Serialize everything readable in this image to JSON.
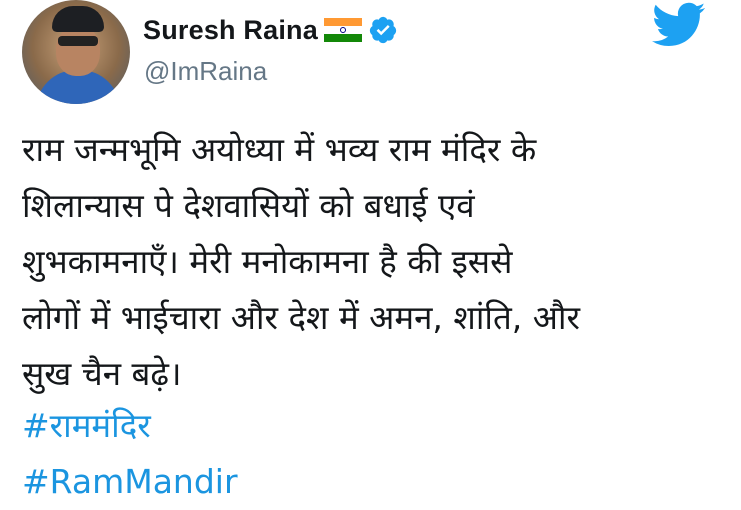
{
  "user": {
    "name": "Suresh Raina",
    "handle": "@ImRaina",
    "flag_icon": "india-flag-emoji",
    "verified_icon": "verified-badge-icon"
  },
  "tweet": {
    "text": "राम जन्मभूमि अयोध्या में भव्य राम मंदिर के\nशिलान्यास पे देशवासियों को बधाई एवं\nशुभकामनाएँ। मेरी मनोकामना है की इससे\nलोगों में भाईचारा और देश में अमन, शांति, और\nसुख चैन बढ़े।",
    "hashtags": [
      "#राममंदिर",
      "#RamMandir"
    ]
  },
  "colors": {
    "text": "#14171a",
    "secondary": "#657786",
    "link": "#1b95e0",
    "twitter_blue": "#1da1f2"
  },
  "icons": {
    "logo": "twitter-bird-icon"
  }
}
